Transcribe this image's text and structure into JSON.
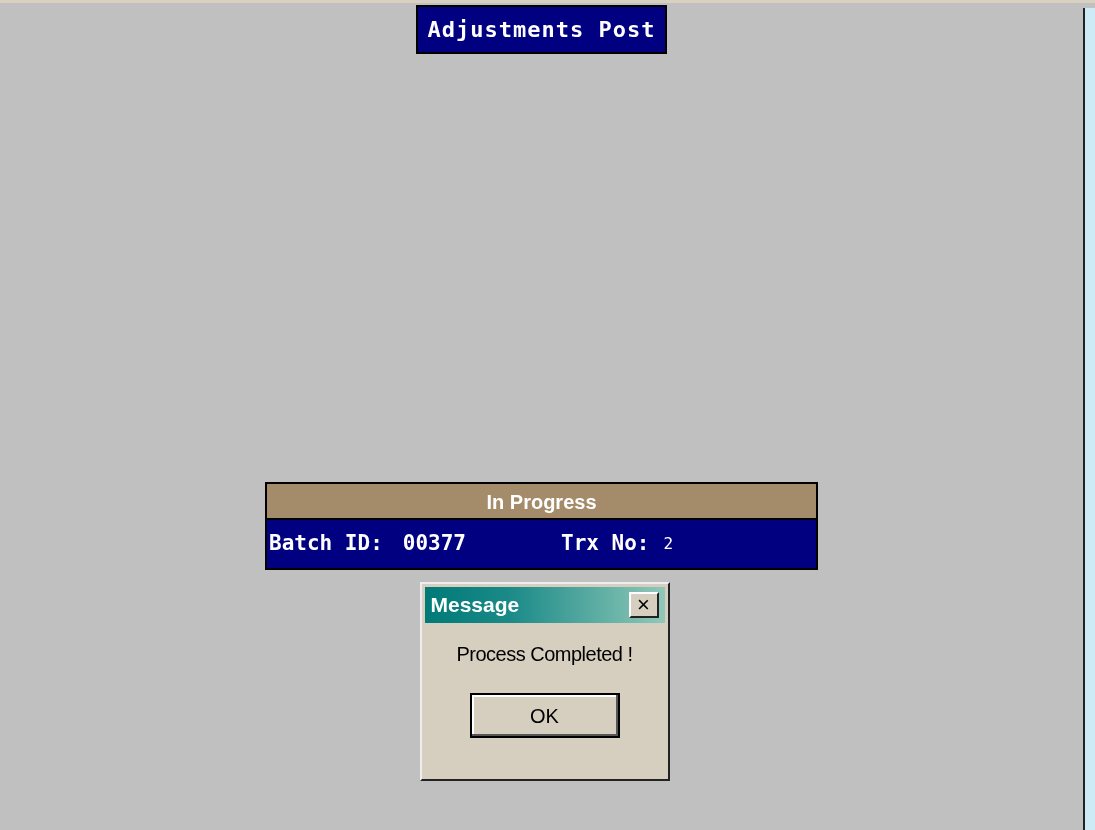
{
  "title": "Adjustments Post",
  "progress": {
    "heading": "In Progress",
    "batch_label": "Batch ID:",
    "batch_value": "00377",
    "trx_label": "Trx No:",
    "trx_value": "2"
  },
  "dialog": {
    "title": "Message",
    "close": "×",
    "message": "Process Completed !",
    "button": "OK"
  }
}
